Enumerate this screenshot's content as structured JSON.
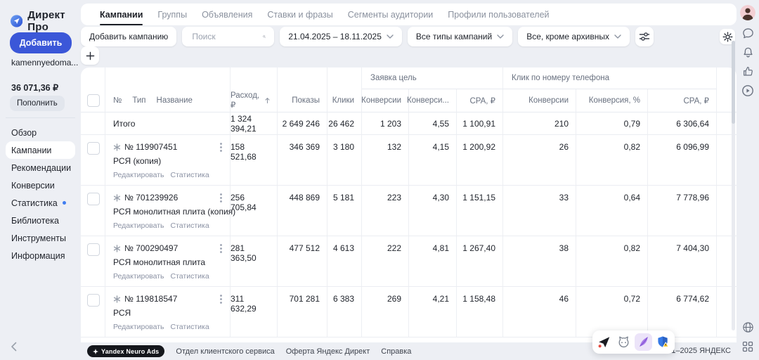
{
  "brand": {
    "name": "Директ Про"
  },
  "colors": {
    "accent_blue": "#3b57d8",
    "page_bg": "#edeff4",
    "text_dark": "#21252d",
    "text_gray": "#8a919e",
    "notification_dot": "#3f7df0"
  },
  "icons": {
    "logo": "direct-logo",
    "search": "magnifier",
    "filters": "sliders",
    "settings": "gear",
    "sort": "arrow-up",
    "row_menu": "kebab",
    "campaign_status": "paused-asterisk",
    "add": "plus",
    "rail": [
      "avatar",
      "chat",
      "bell",
      "thumbs-up",
      "play",
      "globe",
      "apps-grid"
    ],
    "floating": [
      "paper-plane",
      "pet",
      "feather",
      "shield-warning"
    ]
  },
  "sidebar": {
    "add_button": "Добавить",
    "account_name": "kamennyedoma...",
    "balance": "36 071,36 ₽",
    "topup_button": "Пополнить",
    "menu": [
      {
        "label": "Обзор"
      },
      {
        "label": "Кампании",
        "active": true
      },
      {
        "label": "Рекомендации"
      },
      {
        "label": "Конверсии"
      },
      {
        "label": "Статистика",
        "dot": true
      },
      {
        "label": "Библиотека"
      },
      {
        "label": "Инструменты"
      },
      {
        "label": "Информация"
      }
    ]
  },
  "tabs": [
    {
      "label": "Кампании",
      "active": true
    },
    {
      "label": "Группы"
    },
    {
      "label": "Объявления"
    },
    {
      "label": "Ставки и фразы"
    },
    {
      "label": "Сегменты аудитории"
    },
    {
      "label": "Профили пользователей"
    }
  ],
  "toolbar": {
    "add_campaign_button": "Добавить кампанию",
    "search_placeholder": "Поиск",
    "date_range": "21.04.2025 – 18.11.2025",
    "campaign_type_filter": "Все типы кампаний",
    "archive_filter": "Все, кроме архивных"
  },
  "table": {
    "group_headers": {
      "lead_goal": "Заявка цель",
      "phone_click": "Клик по номеру телефона"
    },
    "columns": {
      "num": "№",
      "type": "Тип",
      "name": "Название",
      "cost": "Расход, ₽",
      "impressions": "Показы",
      "clicks": "Клики",
      "conversions1": "Конверсии",
      "conv_rate1": "Конверси...",
      "cpa1": "CPA, ₽",
      "conversions2": "Конверсии",
      "conv_rate2": "Конверсия, %",
      "cpa2": "CPA, ₽"
    },
    "total_row": {
      "label": "Итого",
      "vals": [
        "1 324 394,21",
        "2 649 246",
        "26 462",
        "1 203",
        "4,55",
        "1 100,91",
        "210",
        "0,79",
        "6 306,64"
      ]
    },
    "row_actions": {
      "edit": "Редактировать",
      "stats": "Статистика"
    },
    "rows": [
      {
        "num": "№ 119907451",
        "name": "РСЯ (копия)",
        "vals": [
          "158 521,68",
          "346 369",
          "3 180",
          "132",
          "4,15",
          "1 200,92",
          "26",
          "0,82",
          "6 096,99"
        ]
      },
      {
        "num": "№ 701239926",
        "name": "РСЯ монолитная плита (копия)",
        "vals": [
          "256 705,84",
          "448 869",
          "5 181",
          "223",
          "4,30",
          "1 151,15",
          "33",
          "0,64",
          "7 778,96"
        ]
      },
      {
        "num": "№ 700290497",
        "name": "РСЯ монолитная плита",
        "vals": [
          "281 363,50",
          "477 512",
          "4 613",
          "222",
          "4,81",
          "1 267,40",
          "38",
          "0,82",
          "7 404,30"
        ]
      },
      {
        "num": "№ 119818547",
        "name": "РСЯ",
        "vals": [
          "311 632,29",
          "701 281",
          "6 383",
          "269",
          "4,21",
          "1 158,48",
          "46",
          "0,72",
          "6 774,62"
        ]
      }
    ]
  },
  "footer": {
    "badge": "Yandex Neuro Ads",
    "links": [
      {
        "label": "Отдел клиентского сервиса"
      },
      {
        "label": "Оферта Яндекс Директ"
      },
      {
        "label": "Справка"
      }
    ],
    "copyright": "© 2001–2025 ЯНДЕКС"
  }
}
